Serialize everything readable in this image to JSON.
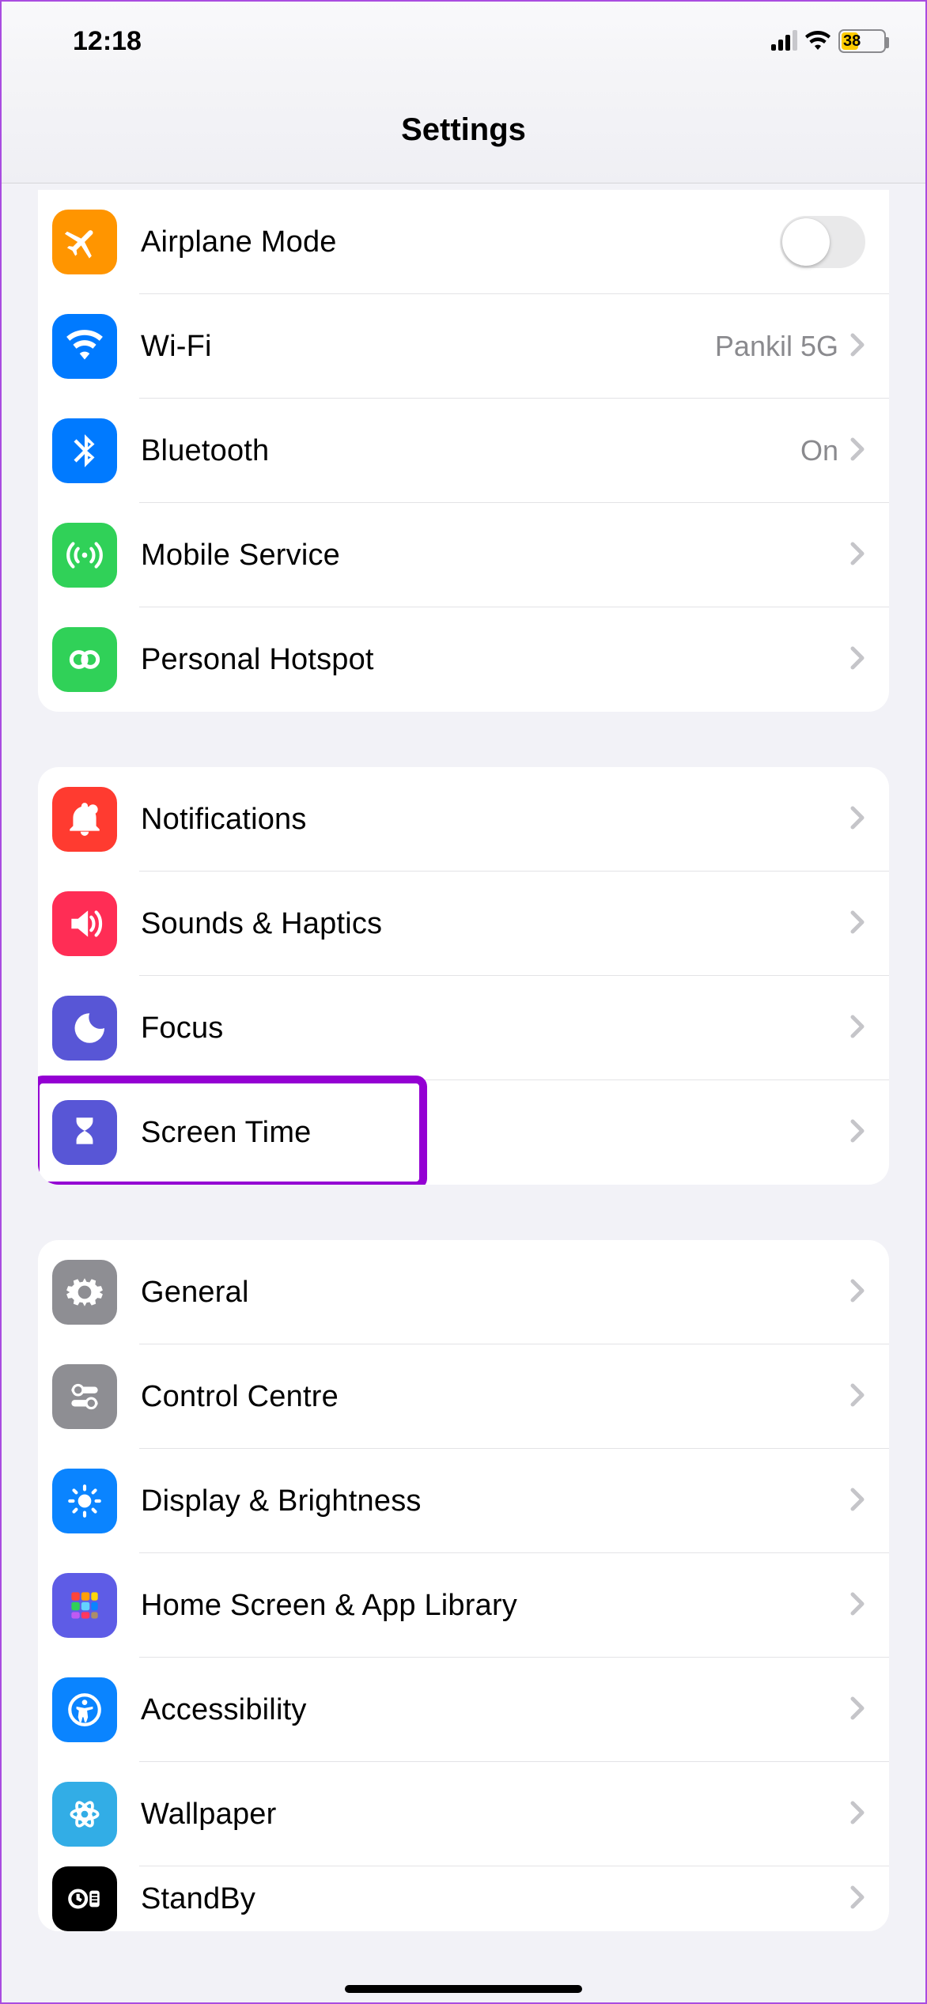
{
  "statusbar": {
    "time": "12:18",
    "battery_percent": "38"
  },
  "header": {
    "title": "Settings"
  },
  "groups": [
    {
      "rows": [
        {
          "id": "airplane",
          "label": "Airplane Mode",
          "control": "toggle",
          "toggle_on": false
        },
        {
          "id": "wifi",
          "label": "Wi-Fi",
          "value": "Pankil 5G",
          "control": "disclosure"
        },
        {
          "id": "bluetooth",
          "label": "Bluetooth",
          "value": "On",
          "control": "disclosure"
        },
        {
          "id": "cellular",
          "label": "Mobile Service",
          "control": "disclosure"
        },
        {
          "id": "hotspot",
          "label": "Personal Hotspot",
          "control": "disclosure"
        }
      ]
    },
    {
      "rows": [
        {
          "id": "notifications",
          "label": "Notifications",
          "control": "disclosure"
        },
        {
          "id": "sounds",
          "label": "Sounds & Haptics",
          "control": "disclosure"
        },
        {
          "id": "focus",
          "label": "Focus",
          "control": "disclosure"
        },
        {
          "id": "screentime",
          "label": "Screen Time",
          "control": "disclosure",
          "highlighted": true
        }
      ]
    },
    {
      "rows": [
        {
          "id": "general",
          "label": "General",
          "control": "disclosure"
        },
        {
          "id": "controlcentre",
          "label": "Control Centre",
          "control": "disclosure"
        },
        {
          "id": "display",
          "label": "Display & Brightness",
          "control": "disclosure"
        },
        {
          "id": "homescreen",
          "label": "Home Screen & App Library",
          "control": "disclosure"
        },
        {
          "id": "accessibility",
          "label": "Accessibility",
          "control": "disclosure"
        },
        {
          "id": "wallpaper",
          "label": "Wallpaper",
          "control": "disclosure"
        },
        {
          "id": "standby",
          "label": "StandBy",
          "control": "disclosure"
        }
      ]
    }
  ]
}
